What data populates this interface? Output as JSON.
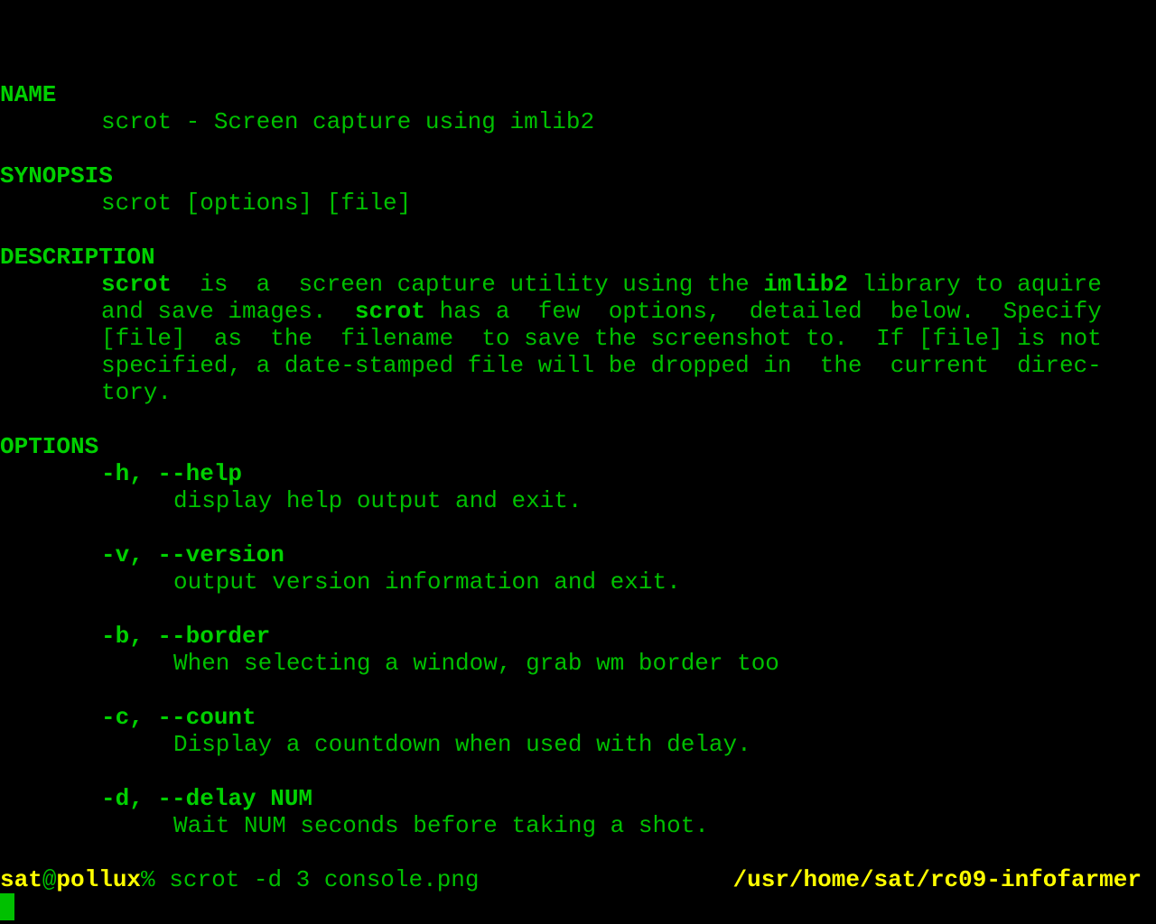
{
  "man": {
    "name_heading": "NAME",
    "name_text": "scrot - Screen capture using imlib2",
    "synopsis_heading": "SYNOPSIS",
    "synopsis_text": "scrot [options] [file]",
    "description_heading": "DESCRIPTION",
    "desc": {
      "l1a": "scrot",
      "l1b": "  is  a  screen capture utility using the ",
      "l1c": "imlib2",
      "l1d": " library to aquire",
      "l2a": "and save images.  ",
      "l2b": "scrot",
      "l2c": " has a  few  options,  detailed  below.  Specify",
      "l3": "[file]  as  the  filename  to save the screenshot to.  If [file] is not",
      "l4": "specified, a date-stamped file will be dropped in  the  current  direc-",
      "l5": "tory."
    },
    "options_heading": "OPTIONS",
    "options": [
      {
        "flag": "-h, --help",
        "desc": "display help output and exit."
      },
      {
        "flag": "-v, --version",
        "desc": "output version information and exit."
      },
      {
        "flag": "-b, --border",
        "desc": "When selecting a window, grab wm border too"
      },
      {
        "flag": "-c, --count",
        "desc": "Display a countdown when used with delay."
      },
      {
        "flag": "-d, --delay NUM",
        "desc": "Wait NUM seconds before taking a shot."
      }
    ]
  },
  "prompt": {
    "user": "sat",
    "at": "@",
    "host": "pollux",
    "symbol": "%",
    "command": " scrot -d 3 console.png",
    "cwd": "/usr/home/sat/rc09-infofarmer"
  }
}
